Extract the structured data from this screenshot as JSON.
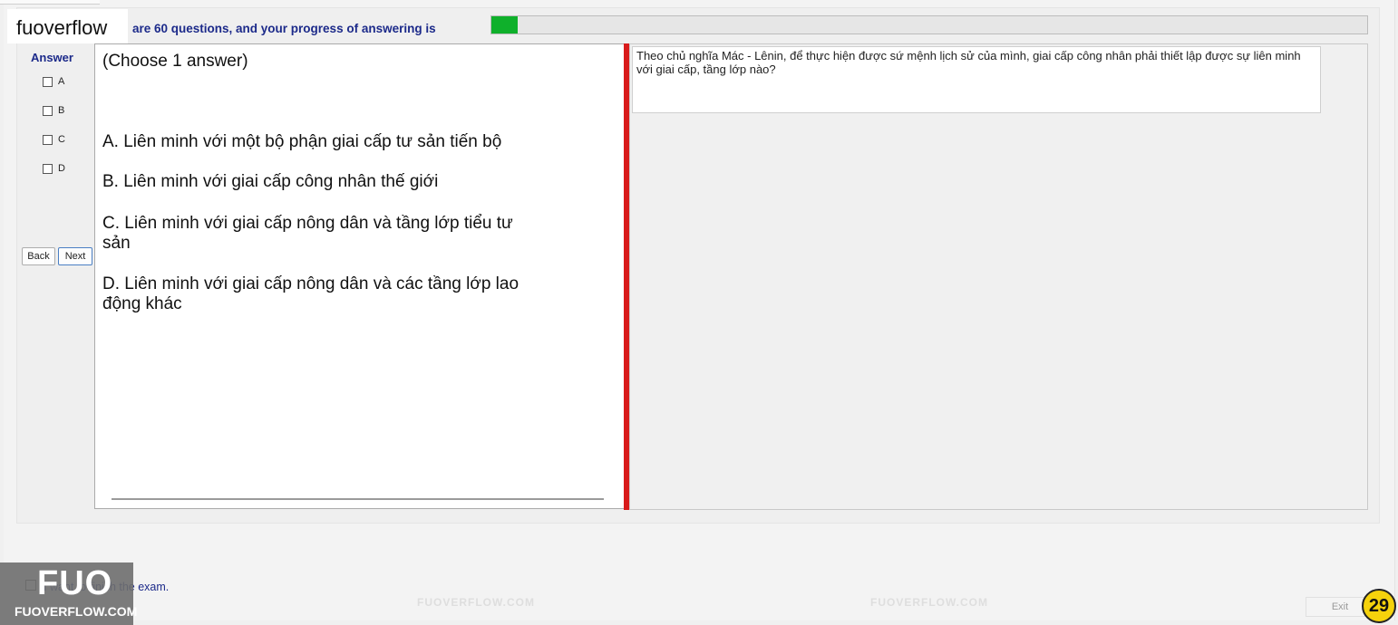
{
  "brand": {
    "name": "fuoverflow"
  },
  "progress": {
    "text": "are 60 questions, and your progress of answering is",
    "fraction": 0.03,
    "fill_color": "#0fb02b"
  },
  "answer_panel": {
    "label": "Answer",
    "options": [
      "A",
      "B",
      "C",
      "D"
    ],
    "back_label": "Back",
    "next_label": "Next"
  },
  "answers": {
    "instruction": "(Choose 1 answer)",
    "items": [
      "A.  Liên minh với một bộ phận giai cấp tư sản tiến bộ",
      "B.  Liên minh với giai cấp công nhân thế giới",
      "C.  Liên minh với giai cấp nông dân và tầng lớp tiểu tư sản",
      "D.  Liên minh với giai cấp nông dân và các tầng lớp lao động khác"
    ]
  },
  "question": {
    "text": "Theo chủ nghĩa Mác - Lênin, để thực hiện được sứ mệnh lịch sử của mình, giai cấp công nhân phải thiết lập được sự liên minh với giai cấp, tầng lớp nào?"
  },
  "watermark": {
    "text": "FUOVERFLOW.COM"
  },
  "footer": {
    "finish_text": "I want to finish the exam.",
    "exit_label": "Exit",
    "timer": "29",
    "logo_big": "FUO",
    "logo_small": "FUOVERFLOW.COM"
  },
  "colors": {
    "accent_text": "#1c2a8a",
    "divider": "#d81b1b",
    "timer_bg": "#f5d20c"
  }
}
